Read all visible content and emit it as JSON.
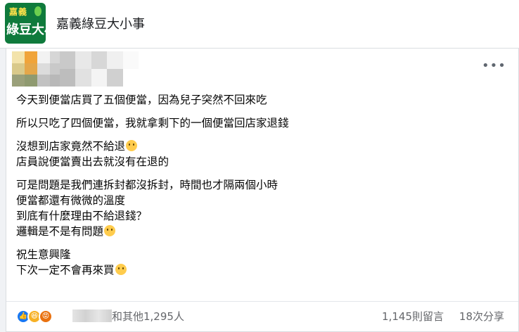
{
  "group": {
    "logo_top": "嘉義",
    "logo_bottom": "綠豆大小",
    "name": "嘉義綠豆大小事"
  },
  "post": {
    "more_icon": "more-horizontal-icon",
    "paragraphs": [
      {
        "lines": [
          "今天到便當店買了五個便當，因為兒子突然不回來吃"
        ]
      },
      {
        "lines": [
          "所以只吃了四個便當，我就拿剩下的一個便當回店家退錢"
        ]
      },
      {
        "lines": [
          "沒想到店家竟然不給退",
          "店員說便當賣出去就沒有在退的"
        ]
      },
      {
        "lines": [
          "可是問題是我們連拆封都沒拆封，時間也才隔兩個小時",
          "便當都還有微微的溫度",
          "到底有什麼理由不給退錢？",
          "邏輯是不是有問題"
        ]
      },
      {
        "lines": [
          "祝生意興隆",
          "下次一定不會再來買"
        ]
      }
    ]
  },
  "footer": {
    "reaction_icons": [
      "like-icon",
      "haha-icon",
      "angry-icon"
    ],
    "reaction_text": "和其他1,295人",
    "comment_count": "1,145則留言",
    "share_count": "18次分享"
  },
  "colors": {
    "like": "#1877f2",
    "haha": "#f7b125",
    "angry": "#e9710f",
    "muted_text": "#65676b",
    "brand_green": "#0f7a3c"
  }
}
